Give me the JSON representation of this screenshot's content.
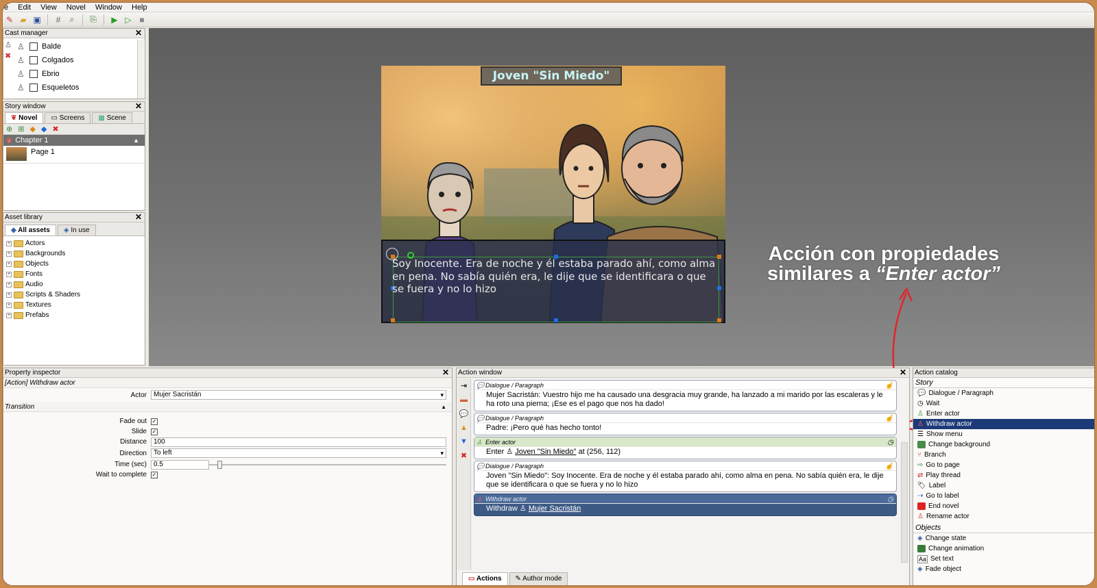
{
  "menu": [
    "e",
    "Edit",
    "View",
    "Novel",
    "Window",
    "Help"
  ],
  "cast_manager": {
    "title": "Cast manager",
    "items": [
      "Balde",
      "Colgados",
      "Ebrio",
      "Esqueletos"
    ]
  },
  "story_window": {
    "title": "Story window",
    "tabs": [
      "Novel",
      "Screens",
      "Scene"
    ],
    "chapter": "Chapter 1",
    "page": "Page 1"
  },
  "asset_library": {
    "title": "Asset library",
    "tabs": [
      "All assets",
      "In use"
    ],
    "folders": [
      "Actors",
      "Backgrounds",
      "Objects",
      "Fonts",
      "Audio",
      "Scripts & Shaders",
      "Textures",
      "Prefabs"
    ]
  },
  "scene": {
    "nameplate": "Joven \"Sin Miedo\"",
    "dialog": "Soy Inocente. Era de noche y él estaba parado ahí, como alma en pena. No sabía quién era, le dije que se identificara o que se fuera y no lo hizo"
  },
  "annotation": {
    "line1": "Acción con propiedades",
    "line2_prefix": "similares a ",
    "line2_italic": "“Enter actor”"
  },
  "property_inspector": {
    "title": "Property inspector",
    "header": "[Action] Withdraw actor",
    "actor_label": "Actor",
    "actor_value": "Mujer Sacristán",
    "transition_label": "Transition",
    "fade_out_label": "Fade out",
    "slide_label": "Slide",
    "distance_label": "Distance",
    "distance_value": "100",
    "direction_label": "Direction",
    "direction_value": "To left",
    "time_label": "Time (sec)",
    "time_value": "0.5",
    "wait_label": "Wait to complete"
  },
  "action_window": {
    "title": "Action window",
    "actions": [
      {
        "type": "Dialogue / Paragraph",
        "text": "Mujer Sacristán: Vuestro hijo me ha causado una desgracia muy grande, ha lanzado a mi marido por las escaleras y le ha roto una pierna; ¡Ese es el pago que nos ha dado!"
      },
      {
        "type": "Dialogue / Paragraph",
        "text": "Padre: ¡Pero qué has hecho tonto!"
      },
      {
        "type": "Enter actor",
        "prefix": "Enter",
        "actor": "Joven \"Sin Miedo\"",
        "suffix": "at (256, 112)"
      },
      {
        "type": "Dialogue / Paragraph",
        "text": "Joven \"Sin Miedo\": Soy Inocente. Era de noche y él estaba parado ahí, como alma en pena. No sabía quién era, le dije que se identificara o que se fuera y no lo hizo"
      },
      {
        "type": "Withdraw actor",
        "prefix": "Withdraw",
        "actor": "Mujer Sacristán"
      }
    ],
    "bottom_tabs": [
      "Actions",
      "Author mode"
    ]
  },
  "action_catalog": {
    "title": "Action catalog",
    "story_header": "Story",
    "story_items": [
      "Dialogue / Paragraph",
      "Wait",
      "Enter actor",
      "Withdraw actor",
      "Show menu",
      "Change background",
      "Branch",
      "Go to page",
      "Play thread",
      "Label",
      "Go to label",
      "End novel",
      "Rename actor"
    ],
    "objects_header": "Objects",
    "object_items": [
      "Change state",
      "Change animation",
      "Set text",
      "Fade object"
    ]
  },
  "colors": {
    "accent_red": "#e0262b",
    "selection_blue": "#1d3a78",
    "nameplate_text": "#c8f4f6"
  }
}
